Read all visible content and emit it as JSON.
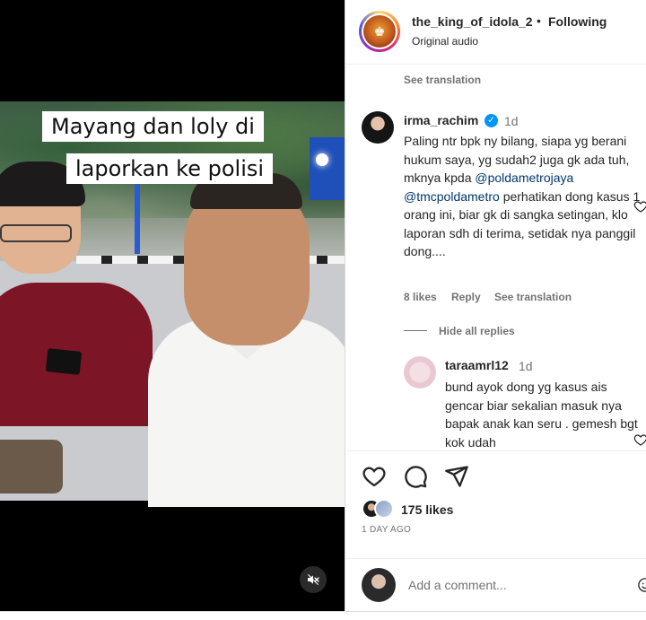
{
  "video": {
    "caption_line1": "Mayang dan loly di",
    "caption_line2": "laporkan ke polisi",
    "mute_icon": "speaker-muted-icon"
  },
  "header": {
    "username": "the_king_of_idola_2",
    "separator": "•",
    "follow_state": "Following",
    "audio": "Original audio"
  },
  "comments": {
    "top_see_translation": "See translation",
    "items": [
      {
        "username": "irma_rachim",
        "verified": "✓",
        "time": "1d",
        "text_a": "Paling ntr bpk ny bilang, siapa yg berani hukum saya, yg sudah2 juga gk ada tuh, mknya kpda ",
        "mention1": "@poldametrojaya",
        "text_b": " ",
        "mention2": "@tmcpoldametro",
        "text_c": " perhatikan dong kasus 1 orang ini, biar gk di sangka setingan, klo laporan sdh di terima, setidak nya panggil dong....",
        "likes": "8 likes",
        "reply": "Reply",
        "see_translation": "See translation"
      }
    ],
    "hide_replies": "Hide all replies",
    "reply": {
      "username": "taraamrl12",
      "time": "1d",
      "text": "bund ayok dong yg kasus ais gencar biar sekalian masuk nya bapak anak kan seru . gemesh bgt kok udah"
    }
  },
  "actions": {
    "likes": "175 likes",
    "posted": "1 DAY AGO"
  },
  "add_comment": {
    "placeholder": "Add a comment..."
  }
}
